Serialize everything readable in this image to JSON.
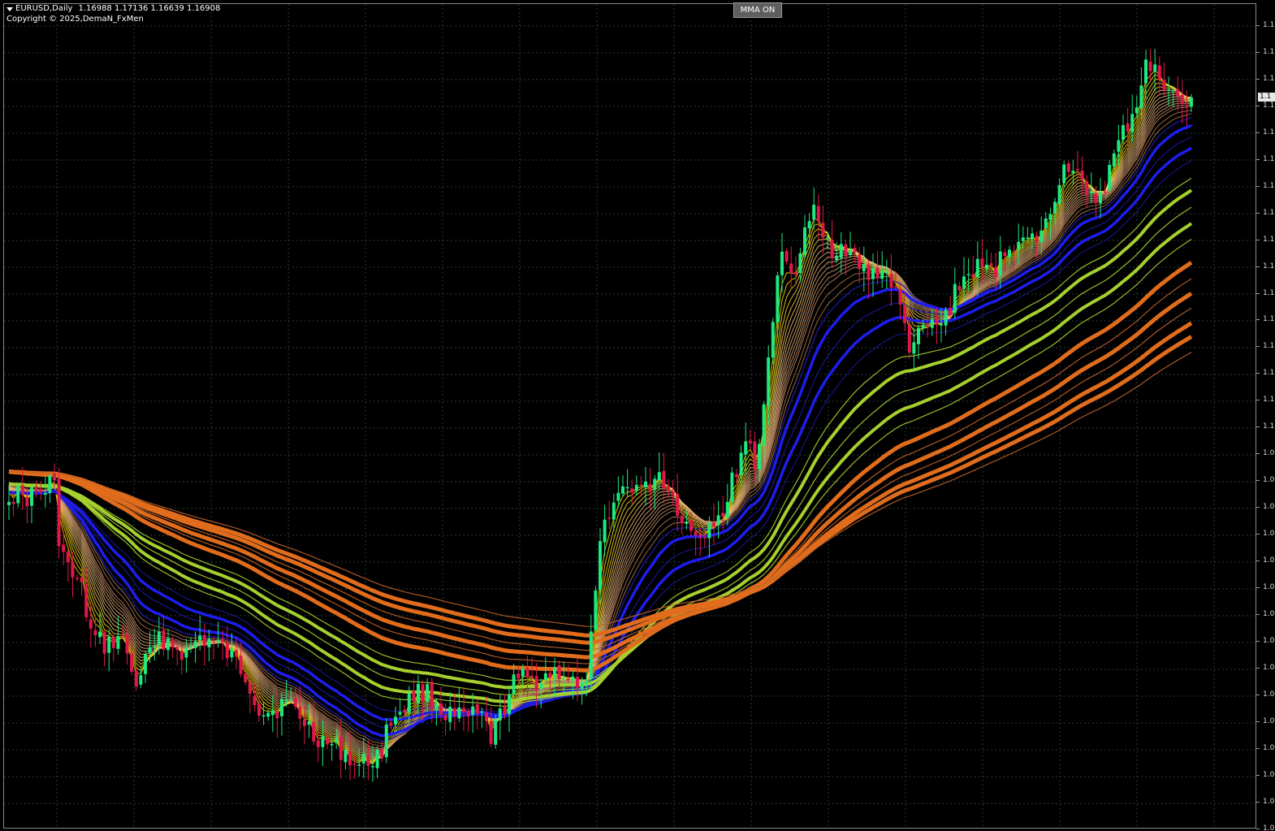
{
  "window": {
    "symbol": "EURUSD",
    "timeframe": "Daily",
    "symbol_label": "EURUSD,Daily",
    "ohlc": {
      "open": "1.16988",
      "high": "1.17136",
      "low": "1.16639",
      "close": "1.16908"
    },
    "ohlc_text": "1.16988 1.17136 1.16639 1.16908",
    "copyright": "Copyright © 2025,DemaN_FxMen"
  },
  "controls": {
    "mma_button_label": "MMA ON"
  },
  "price_scale": {
    "labels": [
      "1.1",
      "1.1",
      "1.1",
      "1.1",
      "1.1",
      "1.1",
      "1.1",
      "1.1",
      "1.1",
      "1.1",
      "1.1",
      "1.1",
      "1.1",
      "1.1",
      "1.1",
      "1.1",
      "1.0",
      "1.0",
      "1.0",
      "1.0",
      "1.0",
      "1.0",
      "1.0",
      "1.0",
      "1.0",
      "1.0",
      "1.0",
      "1.0",
      "1.0",
      "1.0",
      "1.0"
    ],
    "current_price_label": "1.1"
  },
  "colors": {
    "background": "#000000",
    "grid": "#2a3a3a",
    "bull_candle": "#1ee87e",
    "bear_candle": "#e0184a",
    "fast_ma": [
      "#ffe000",
      "#ffd23c",
      "#f5c86e",
      "#e8b47a",
      "#d8a070",
      "#c48c60",
      "#b07850"
    ],
    "blue_ma": "#1d1df0",
    "navy_ma": "#1a1aa0",
    "green_ma": "#a6d02e",
    "orange_ma": "#e06c1c",
    "thin_orange_ma": "#c0622a"
  },
  "chart_data": {
    "type": "candlestick",
    "symbol": "EURUSD",
    "timeframe": "Daily",
    "last_bar": {
      "open": 1.16988,
      "high": 1.17136,
      "low": 1.16639,
      "close": 1.16908
    },
    "overlay": "Multiple moving averages (ribbon) — fast yellow/beige group, blue group, green group, orange group",
    "indicator_state": "MMA ON"
  }
}
